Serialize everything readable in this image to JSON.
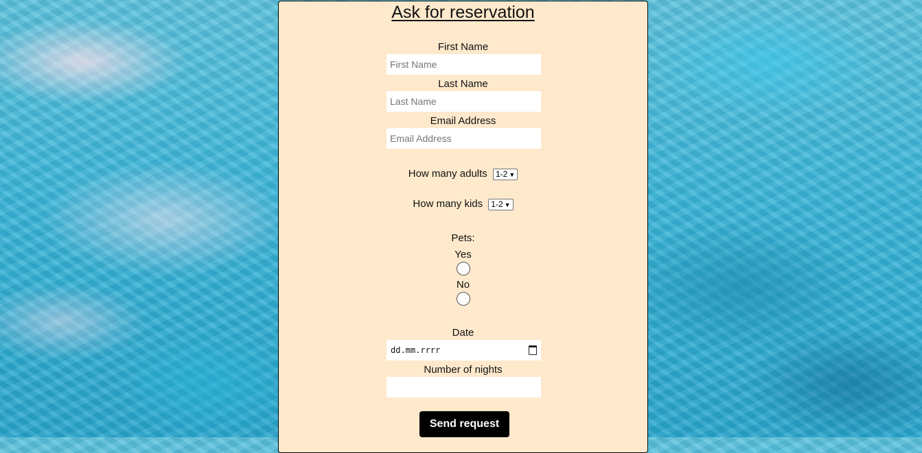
{
  "form": {
    "title": "Ask for reservation",
    "first_name": {
      "label": "First Name",
      "placeholder": "First Name",
      "value": ""
    },
    "last_name": {
      "label": "Last Name",
      "placeholder": "Last Name",
      "value": ""
    },
    "email": {
      "label": "Email Address",
      "placeholder": "Email Address",
      "value": ""
    },
    "adults": {
      "label": "How many adults",
      "selected": "1-2"
    },
    "kids": {
      "label": "How many kids",
      "selected": "1-2"
    },
    "pets": {
      "label": "Pets:",
      "yes_label": "Yes",
      "no_label": "No"
    },
    "date": {
      "label": "Date",
      "placeholder": "dd.mm.rrrr"
    },
    "nights": {
      "label": "Number of nights",
      "value": ""
    },
    "submit_label": "Send request"
  },
  "icons": {
    "calendar": "calendar-icon",
    "dropdown": "chevron-down-icon"
  }
}
